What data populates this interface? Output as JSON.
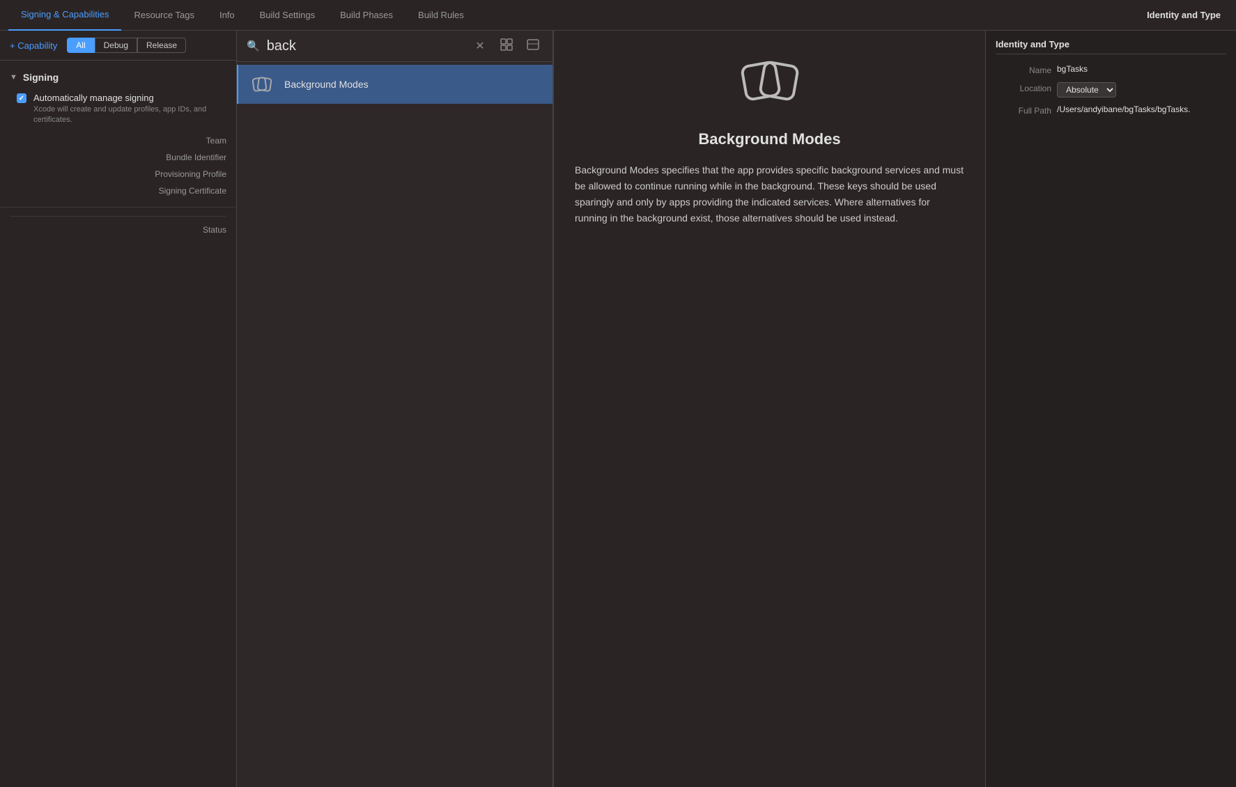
{
  "tabs": [
    {
      "id": "signing",
      "label": "Signing & Capabilities",
      "active": true
    },
    {
      "id": "resource-tags",
      "label": "Resource Tags",
      "active": false
    },
    {
      "id": "info",
      "label": "Info",
      "active": false
    },
    {
      "id": "build-settings",
      "label": "Build Settings",
      "active": false
    },
    {
      "id": "build-phases",
      "label": "Build Phases",
      "active": false
    },
    {
      "id": "build-rules",
      "label": "Build Rules",
      "active": false
    }
  ],
  "identity_panel": {
    "title": "Identity and Type",
    "fields": [
      {
        "label": "Name",
        "value": "bgTasks",
        "type": "text"
      },
      {
        "label": "Location",
        "value": "Absolute",
        "type": "dropdown"
      },
      {
        "label": "Full Path",
        "value": "/Users/andyibane/bgTasks/bgTasks.",
        "type": "text"
      }
    ]
  },
  "capability_bar": {
    "add_label": "+ Capability",
    "filters": [
      {
        "label": "All",
        "active": true
      },
      {
        "label": "Debug",
        "active": false
      },
      {
        "label": "Release",
        "active": false
      }
    ]
  },
  "signing": {
    "section_title": "Signing",
    "auto_sign": {
      "checked": true,
      "label": "Automatically manage signing",
      "description": "Xcode will create and update profiles, app IDs, and certificates."
    },
    "fields": [
      {
        "label": "Team"
      },
      {
        "label": "Bundle Identifier"
      },
      {
        "label": "Provisioning Profile"
      },
      {
        "label": "Signing Certificate"
      }
    ],
    "status_label": "Status"
  },
  "search": {
    "placeholder": "back",
    "value": "back",
    "clear_icon": "✕",
    "grid_icon": "⊞",
    "sidebar_icon": "▤"
  },
  "results": [
    {
      "id": "background-modes",
      "label": "Background Modes",
      "selected": true,
      "icon": "background-modes"
    }
  ],
  "detail": {
    "title": "Background Modes",
    "description": "Background Modes specifies that the app provides specific background services and must be allowed to continue running while in the background. These keys should be used sparingly and only by apps providing the indicated services. Where alternatives for running in the background exist, those alternatives should be used instead."
  }
}
